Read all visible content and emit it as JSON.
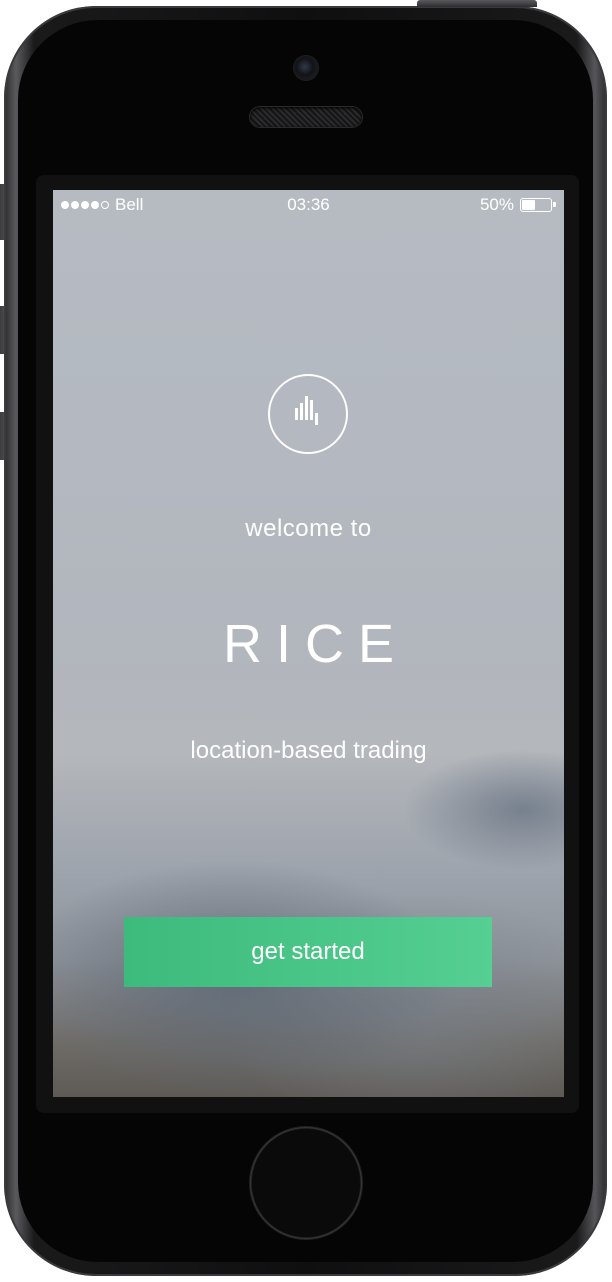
{
  "status_bar": {
    "carrier": "Bell",
    "signal_bars_filled": 4,
    "signal_bars_total": 5,
    "time": "03:36",
    "battery_text": "50%",
    "battery_level": 0.5
  },
  "welcome_screen": {
    "logo_icon": "bar-chart-circle-icon",
    "welcome_text": "welcome to",
    "app_name": "RICE",
    "tagline": "location-based trading",
    "cta_label": "get started"
  },
  "colors": {
    "cta_start": "#3dbb7c",
    "cta_end": "#55cf92",
    "text": "#ffffff",
    "phone_body": "#0f0f10"
  }
}
